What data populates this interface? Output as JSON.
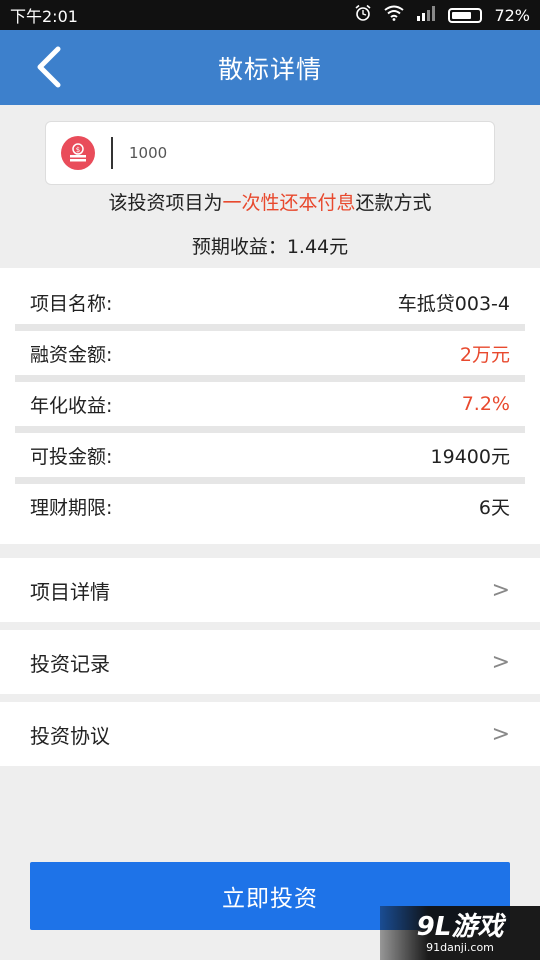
{
  "status_bar": {
    "time": "下午2:01",
    "battery": "72%",
    "battery_level": 0.72
  },
  "header": {
    "title": "散标详情"
  },
  "amount_input": {
    "value": "1000"
  },
  "repayment_note": {
    "prefix": "该投资项目为",
    "highlight": "一次性还本付息",
    "suffix": "还款方式"
  },
  "expected_return": "预期收益：1.44元",
  "info_rows": [
    {
      "label": "项目名称:",
      "value": "车抵贷003-4"
    },
    {
      "label": "融资金额:",
      "value": "2万元"
    },
    {
      "label": "年化收益:",
      "value": "7.2%"
    },
    {
      "label": "可投金额:",
      "value": "19400元"
    },
    {
      "label": "理财期限:",
      "value": "6天"
    }
  ],
  "nav_rows": [
    {
      "label": "项目详情",
      "chevron": ">"
    },
    {
      "label": "投资记录",
      "chevron": ">"
    },
    {
      "label": "投资协议",
      "chevron": ">"
    }
  ],
  "invest_button": "立即投资",
  "watermark": {
    "main": "9L游戏",
    "sub": "91danji.com"
  },
  "colors": {
    "header_bg": "#3d80cc",
    "highlight": "#e8492e",
    "button_bg": "#1e73e8",
    "coin_icon": "#e94c5a"
  }
}
